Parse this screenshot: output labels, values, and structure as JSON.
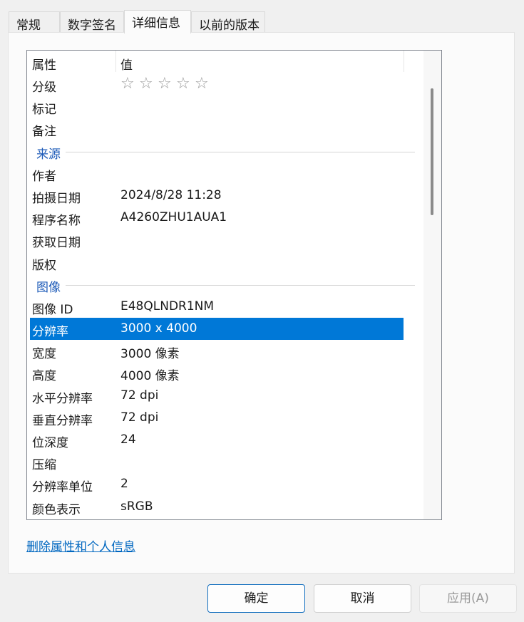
{
  "tabs": [
    {
      "label": "常规"
    },
    {
      "label": "数字签名"
    },
    {
      "label": "详细信息",
      "active": true
    },
    {
      "label": "以前的版本"
    }
  ],
  "columns": {
    "property": "属性",
    "value": "值"
  },
  "rating": {
    "label": "分级",
    "stars": 5,
    "filled": 0,
    "star_glyph": "☆"
  },
  "rows_top": [
    {
      "key": "标记",
      "value": ""
    },
    {
      "key": "备注",
      "value": ""
    }
  ],
  "group_source": {
    "label": "来源"
  },
  "rows_source": [
    {
      "key": "作者",
      "value": ""
    },
    {
      "key": "拍摄日期",
      "value": "2024/8/28 11:28"
    },
    {
      "key": "程序名称",
      "value": "A4260ZHU1AUA1"
    },
    {
      "key": "获取日期",
      "value": ""
    },
    {
      "key": "版权",
      "value": ""
    }
  ],
  "group_image": {
    "label": "图像"
  },
  "rows_image": [
    {
      "key": "图像 ID",
      "value": "E48QLNDR1NM"
    },
    {
      "key": "分辨率",
      "value": "3000 x 4000",
      "selected": true
    },
    {
      "key": "宽度",
      "value": "3000 像素"
    },
    {
      "key": "高度",
      "value": "4000 像素"
    },
    {
      "key": "水平分辨率",
      "value": "72 dpi"
    },
    {
      "key": "垂直分辨率",
      "value": "72 dpi"
    },
    {
      "key": "位深度",
      "value": "24"
    },
    {
      "key": "压缩",
      "value": ""
    },
    {
      "key": "分辨率单位",
      "value": "2"
    },
    {
      "key": "颜色表示",
      "value": "sRGB"
    }
  ],
  "remove_link": "删除属性和个人信息",
  "buttons": {
    "ok": "确定",
    "cancel": "取消",
    "apply": "应用(A)"
  },
  "colors": {
    "selection": "#0078d7",
    "group_heading": "#1e5bb8",
    "link": "#0067c0"
  }
}
